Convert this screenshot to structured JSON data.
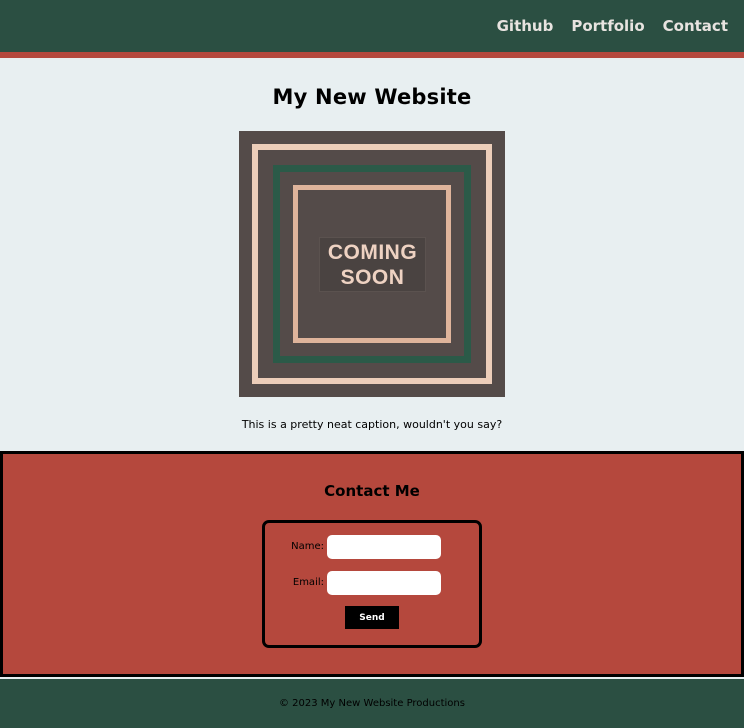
{
  "nav": {
    "links": [
      {
        "label": "Github"
      },
      {
        "label": "Portfolio"
      },
      {
        "label": "Contact"
      }
    ]
  },
  "main": {
    "title": "My New Website",
    "image": {
      "line1": "COMING",
      "line2": "SOON"
    },
    "caption": "This is a pretty neat caption, wouldn't you say?"
  },
  "contact": {
    "title": "Contact Me",
    "name_label": "Name:",
    "name_value": "",
    "email_label": "Email:",
    "email_value": "",
    "send_label": "Send"
  },
  "footer": {
    "text": "© 2023 My New Website Productions"
  },
  "colors": {
    "nav_bg": "#2b4f42",
    "accent_red": "#b5483d",
    "page_bg": "#e8eff1",
    "image_bg": "#544b49",
    "frame_peach": "#eccdb9",
    "frame_green": "#2b5a48"
  }
}
